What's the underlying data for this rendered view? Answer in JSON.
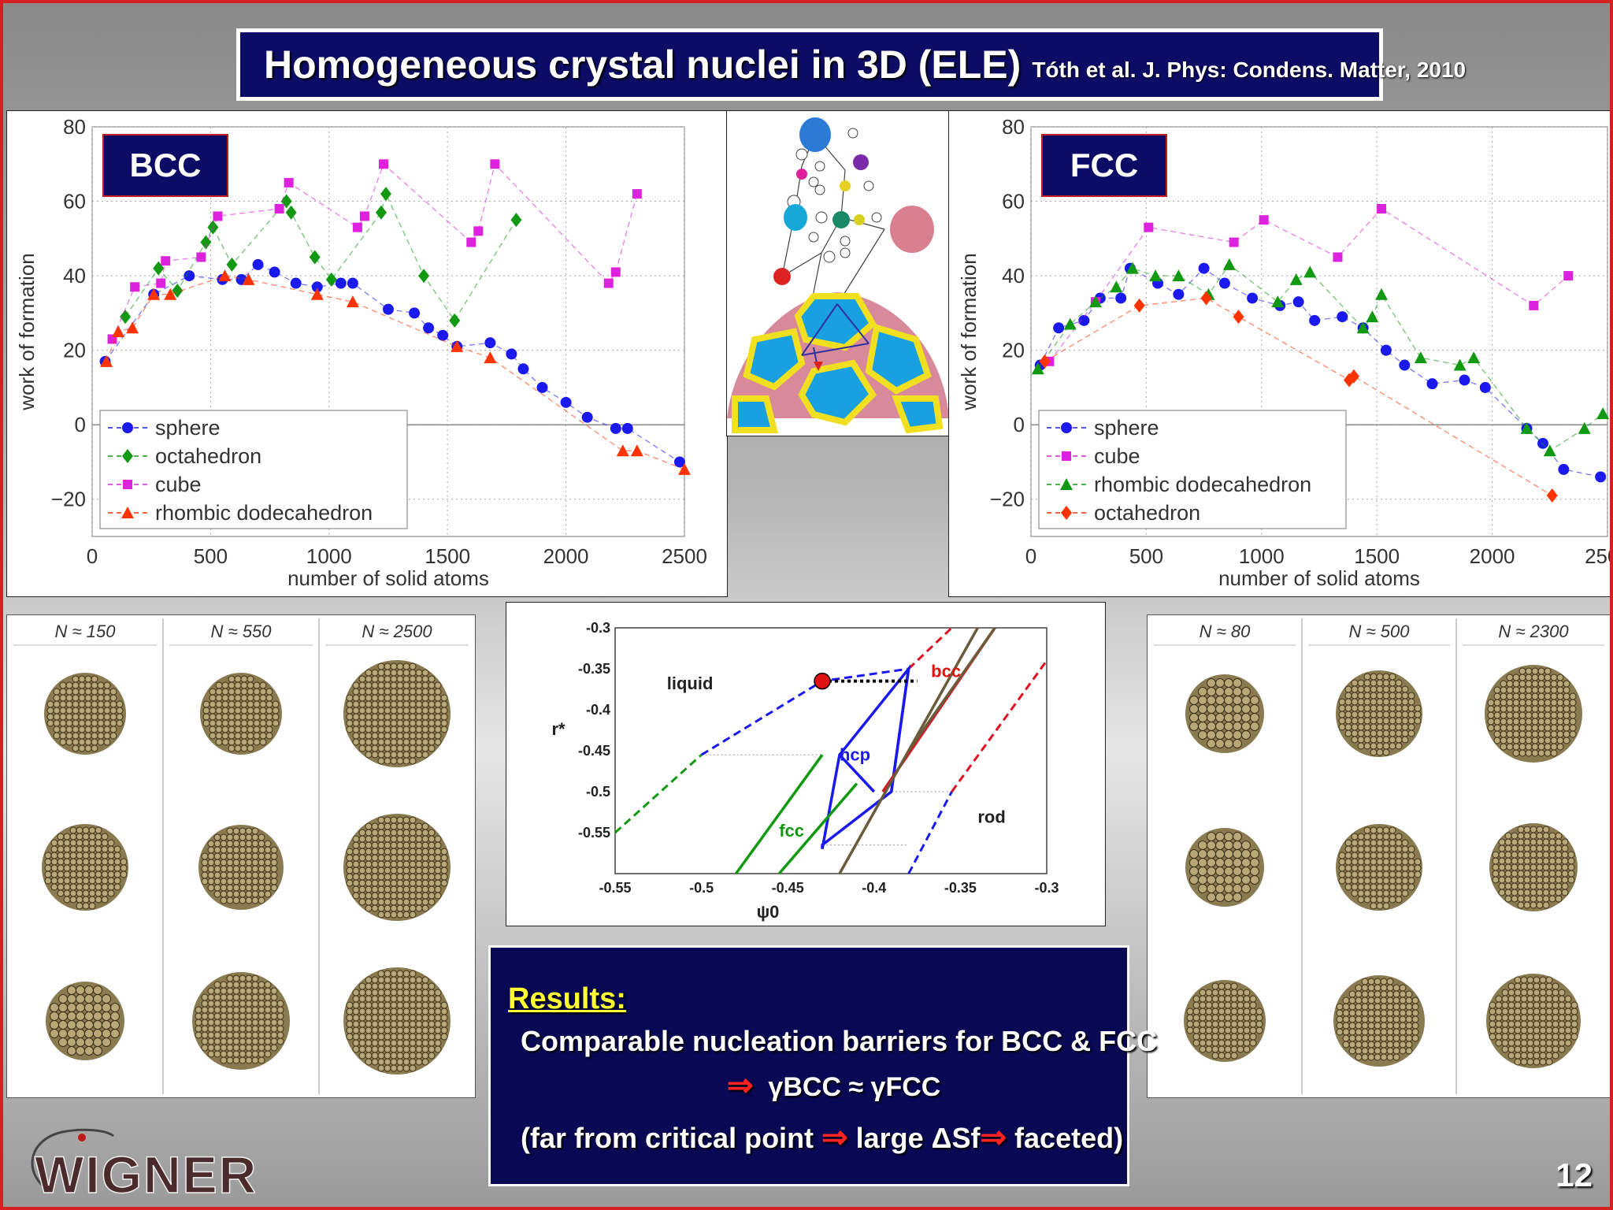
{
  "title": {
    "main": "Homogeneous crystal nuclei in 3D (ELE)",
    "reference": "Tóth et al. J. Phys: Condens. Matter, 2010"
  },
  "bcc_label": "BCC",
  "fcc_label": "FCC",
  "shape_sheets": {
    "bcc_columns": [
      "N ≈ 150",
      "N ≈ 550",
      "N ≈ 2500"
    ],
    "fcc_columns": [
      "N ≈ 80",
      "N ≈ 500",
      "N ≈ 2300"
    ]
  },
  "phase_labels": {
    "liquid": "liquid",
    "bcc": "bcc",
    "hcp": "hcp",
    "fcc": "fcc",
    "rod": "rod"
  },
  "results": {
    "heading": "Results:",
    "line1": "Comparable nucleation barriers for BCC & FCC",
    "arrow": "⇒",
    "gamma_relation": "γBCC ≈ γFCC",
    "line3_a": "(far from critical point",
    "line3_b": "large ΔSf",
    "line3_c": "faceted)"
  },
  "logo_text": "WIGNER",
  "page_number": "12",
  "colors": {
    "title_bg": "#0c0c66",
    "label_bg": "#0c0c66",
    "sphere": "#1a1aee",
    "octahedron": "#119911",
    "cube": "#dd22dd",
    "rhombic": "#ff3300",
    "accent_red": "#d42020"
  },
  "chart_data": [
    {
      "type": "scatter",
      "title": "",
      "panel_label": "BCC",
      "xlabel": "number of solid atoms",
      "ylabel": "work of formation",
      "xlim": [
        0,
        2500
      ],
      "ylim": [
        -30,
        80
      ],
      "xticks": [
        0,
        500,
        1000,
        1500,
        2000,
        2500
      ],
      "yticks": [
        -20,
        0,
        20,
        40,
        60,
        80
      ],
      "grid": true,
      "legend_position": "bottom-left",
      "series": [
        {
          "name": "sphere",
          "color": "#1a1aee",
          "marker": "circle",
          "x": [
            55,
            260,
            410,
            550,
            630,
            700,
            770,
            860,
            950,
            1050,
            1100,
            1250,
            1360,
            1420,
            1480,
            1540,
            1680,
            1770,
            1820,
            1900,
            2000,
            2090,
            2210,
            2260,
            2480
          ],
          "y": [
            17,
            35,
            40,
            39,
            39,
            43,
            41,
            38,
            37,
            38,
            38,
            31,
            30,
            26,
            24,
            21,
            22,
            19,
            15,
            10,
            6,
            2,
            -1,
            -1,
            -10
          ]
        },
        {
          "name": "octahedron",
          "color": "#119911",
          "marker": "diamond",
          "x": [
            140,
            280,
            360,
            480,
            510,
            590,
            820,
            840,
            940,
            1010,
            1220,
            1240,
            1400,
            1530,
            1790
          ],
          "y": [
            29,
            42,
            36,
            49,
            53,
            43,
            60,
            57,
            45,
            39,
            57,
            62,
            40,
            28,
            55
          ]
        },
        {
          "name": "cube",
          "color": "#dd22dd",
          "marker": "square",
          "x": [
            85,
            180,
            290,
            310,
            460,
            530,
            790,
            830,
            1120,
            1150,
            1230,
            1600,
            1630,
            1700,
            2180,
            2210,
            2300
          ],
          "y": [
            23,
            37,
            38,
            44,
            45,
            56,
            58,
            65,
            53,
            56,
            70,
            49,
            52,
            70,
            38,
            41,
            62
          ]
        },
        {
          "name": "rhombic dodecahedron",
          "color": "#ff3300",
          "marker": "triangle",
          "x": [
            60,
            110,
            170,
            260,
            330,
            560,
            660,
            950,
            1100,
            1540,
            1680,
            2240,
            2300,
            2500
          ],
          "y": [
            17,
            25,
            26,
            35,
            35,
            40,
            39,
            35,
            33,
            21,
            18,
            -7,
            -7,
            -12
          ]
        }
      ]
    },
    {
      "type": "scatter",
      "title": "",
      "panel_label": "FCC",
      "xlabel": "number of solid atoms",
      "ylabel": "work of formation",
      "xlim": [
        0,
        2500
      ],
      "ylim": [
        -30,
        80
      ],
      "xticks": [
        0,
        500,
        1000,
        1500,
        2000,
        2500
      ],
      "yticks": [
        -20,
        0,
        20,
        40,
        60,
        80
      ],
      "grid": true,
      "legend_position": "bottom-left",
      "series": [
        {
          "name": "sphere",
          "color": "#1a1aee",
          "marker": "circle",
          "x": [
            40,
            120,
            230,
            300,
            390,
            430,
            550,
            640,
            750,
            840,
            960,
            1080,
            1160,
            1230,
            1350,
            1440,
            1540,
            1620,
            1740,
            1880,
            1970,
            2150,
            2220,
            2310,
            2470
          ],
          "y": [
            16,
            26,
            28,
            34,
            34,
            42,
            38,
            35,
            42,
            38,
            34,
            32,
            33,
            28,
            29,
            26,
            20,
            16,
            11,
            12,
            10,
            -1,
            -5,
            -12,
            -14
          ]
        },
        {
          "name": "cube",
          "color": "#dd22dd",
          "marker": "square",
          "x": [
            80,
            280,
            510,
            880,
            1010,
            1330,
            1520,
            2180,
            2330
          ],
          "y": [
            17,
            33,
            53,
            49,
            55,
            45,
            58,
            32,
            40
          ]
        },
        {
          "name": "rhombic dodecahedron",
          "color": "#119911",
          "marker": "triangle",
          "x": [
            30,
            170,
            280,
            370,
            440,
            540,
            640,
            770,
            860,
            1070,
            1150,
            1210,
            1440,
            1480,
            1520,
            1690,
            1860,
            1920,
            2150,
            2250,
            2400,
            2480
          ],
          "y": [
            15,
            27,
            33,
            37,
            42,
            40,
            40,
            35,
            43,
            33,
            39,
            41,
            26,
            29,
            35,
            18,
            16,
            18,
            -1,
            -7,
            -1,
            3
          ]
        },
        {
          "name": "octahedron",
          "color": "#ff3300",
          "marker": "diamond",
          "x": [
            60,
            470,
            760,
            900,
            1380,
            1400,
            2260
          ],
          "y": [
            17,
            32,
            34,
            29,
            12,
            13,
            -19
          ]
        }
      ]
    },
    {
      "type": "line",
      "title": "",
      "xlabel": "ψ0",
      "ylabel": "r*",
      "xlim": [
        -0.55,
        -0.3
      ],
      "ylim": [
        -0.6,
        -0.3
      ],
      "xticks": [
        -0.55,
        -0.5,
        -0.45,
        -0.4,
        -0.35,
        -0.3
      ],
      "yticks": [
        -0.55,
        -0.5,
        -0.45,
        -0.4,
        -0.35,
        -0.3
      ],
      "annotations": [
        "liquid",
        "bcc",
        "hcp",
        "fcc",
        "rod"
      ],
      "marked_point": {
        "x": -0.43,
        "y": -0.365
      },
      "series": [
        {
          "color": "#1a1aee",
          "x": [
            -0.5,
            -0.43,
            -0.38
          ],
          "y": [
            -0.455,
            -0.365,
            -0.35
          ]
        },
        {
          "color": "#dd1122",
          "x": [
            -0.38,
            -0.355
          ],
          "y": [
            -0.35,
            -0.3
          ]
        },
        {
          "color": "#119911",
          "x": [
            -0.55,
            -0.5
          ],
          "y": [
            -0.55,
            -0.455
          ]
        },
        {
          "color": "#1a1aee",
          "x": [
            -0.38,
            -0.39
          ],
          "y": [
            -0.35,
            -0.5
          ]
        },
        {
          "color": "#1a1aee",
          "x": [
            -0.42,
            -0.4
          ],
          "y": [
            -0.455,
            -0.5
          ]
        },
        {
          "color": "#1a1aee",
          "x": [
            -0.43,
            -0.42,
            -0.38,
            -0.39,
            -0.43,
            -0.43
          ],
          "y": [
            -0.57,
            -0.455,
            -0.35,
            -0.5,
            -0.565,
            -0.57
          ]
        },
        {
          "color": "#119911",
          "x": [
            -0.48,
            -0.43
          ],
          "y": [
            -0.6,
            -0.455
          ]
        },
        {
          "color": "#119911",
          "x": [
            -0.455,
            -0.41
          ],
          "y": [
            -0.6,
            -0.49
          ]
        },
        {
          "color": "#dd1122",
          "x": [
            -0.395,
            -0.33
          ],
          "y": [
            -0.5,
            -0.3
          ]
        },
        {
          "color": "#6b5b3a",
          "x": [
            -0.42,
            -0.34
          ],
          "y": [
            -0.6,
            -0.3
          ]
        },
        {
          "color": "#6b5b3a",
          "x": [
            -0.38,
            -0.33
          ],
          "y": [
            -0.45,
            -0.3
          ]
        },
        {
          "color": "#1a1aee",
          "x": [
            -0.38,
            -0.355
          ],
          "y": [
            -0.6,
            -0.5
          ]
        },
        {
          "color": "#dd1122",
          "x": [
            -0.355,
            -0.3
          ],
          "y": [
            -0.5,
            -0.34
          ]
        }
      ]
    }
  ]
}
